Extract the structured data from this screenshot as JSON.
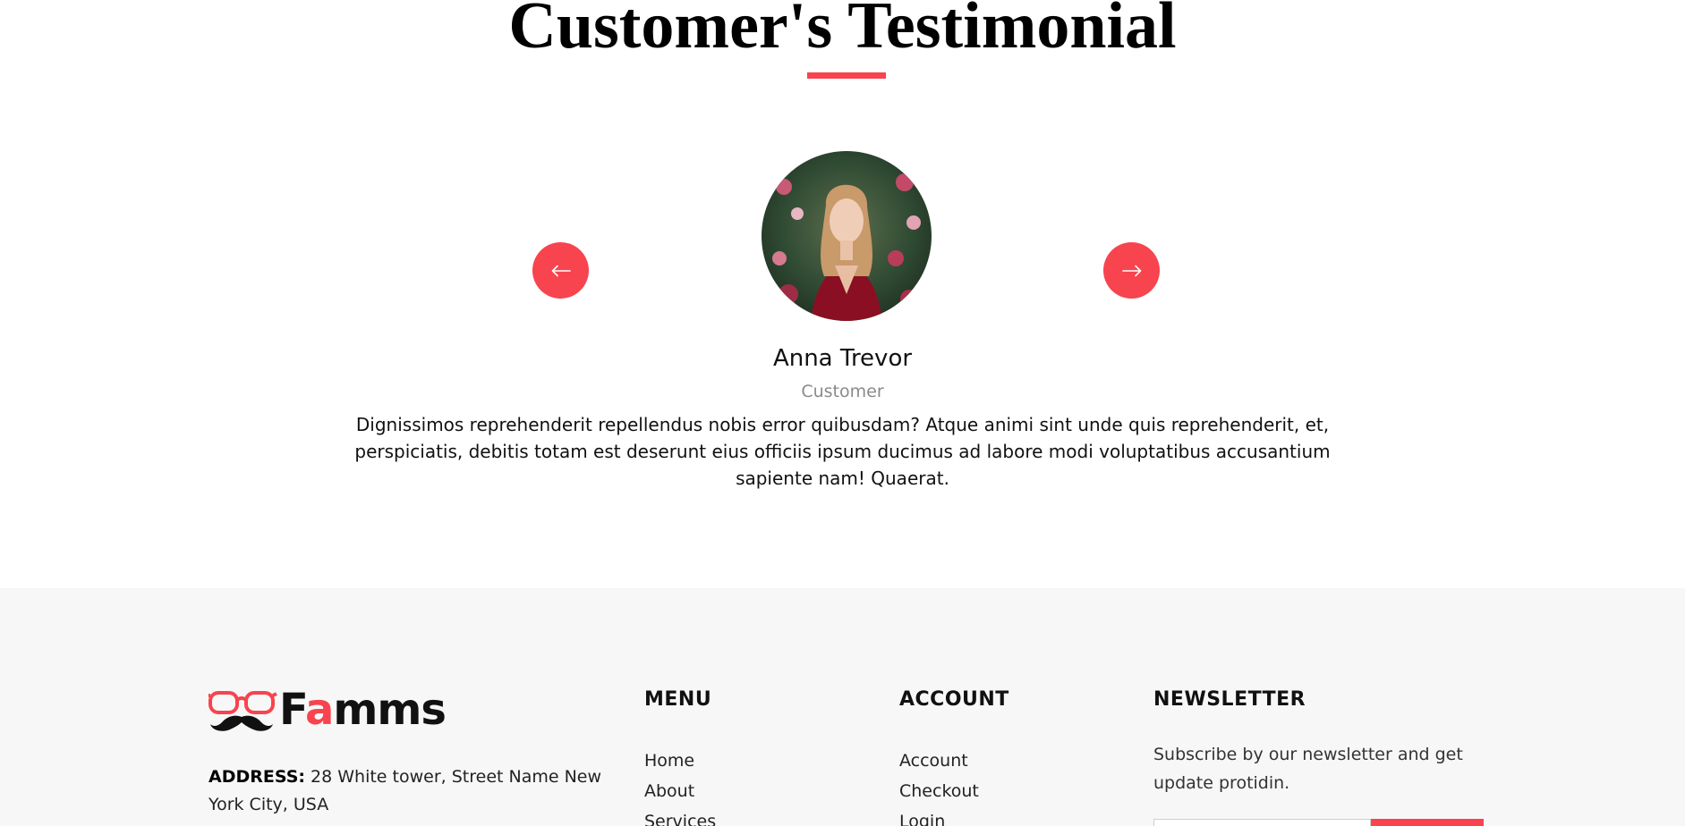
{
  "testimonial": {
    "heading": "Customer's Testimonial",
    "name": "Anna Trevor",
    "role": "Customer",
    "quote": "Dignissimos reprehenderit repellendus nobis error quibusdam? Atque animi sint unde quis reprehenderit, et, perspiciatis, debitis totam est deserunt eius officiis ipsum ducimus ad labore modi voluptatibus accusantium sapiente nam! Quaerat.",
    "prev_icon": "arrow-left-icon",
    "next_icon": "arrow-right-icon"
  },
  "footer": {
    "logo": {
      "text_before": "F",
      "text_accent": "a",
      "text_after": "mms",
      "icon": "glasses-mustache-icon"
    },
    "address": {
      "label": "ADDRESS:",
      "value": "28 White tower, Street Name New York City, USA"
    },
    "menu": {
      "title": "MENU",
      "items": [
        "Home",
        "About",
        "Services"
      ]
    },
    "account": {
      "title": "ACCOUNT",
      "items": [
        "Account",
        "Checkout",
        "Login"
      ]
    },
    "newsletter": {
      "title": "NEWSLETTER",
      "text": "Subscribe by our newsletter and get update protidin.",
      "input_value": "",
      "button_label": ""
    }
  },
  "colors": {
    "accent": "#f7444e",
    "footer_bg": "#f7f7f7",
    "muted": "#8a8a8a"
  }
}
